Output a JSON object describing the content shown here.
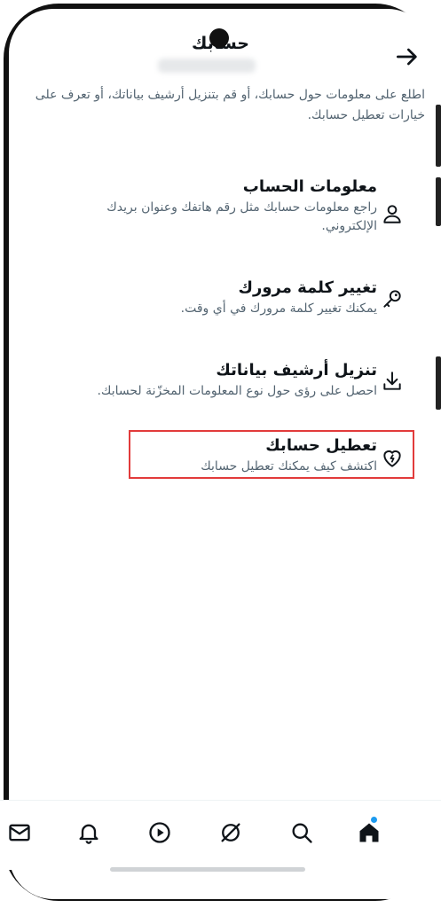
{
  "header": {
    "title": "حسابك"
  },
  "intro_text": "اطلع على معلومات حول حسابك، أو قم بتنزيل أرشيف بياناتك، أو تعرف على خيارات تعطيل حسابك.",
  "items": [
    {
      "title": "معلومات الحساب",
      "description": "راجع معلومات حسابك مثل رقم هاتفك وعنوان بريدك الإلكتروني.",
      "icon": "person-icon"
    },
    {
      "title": "تغيير كلمة مرورك",
      "description": "يمكنك تغيير كلمة مرورك في أي وقت.",
      "icon": "key-icon"
    },
    {
      "title": "تنزيل أرشيف بياناتك",
      "description": "احصل على رؤى حول نوع المعلومات المخزّنة لحسابك.",
      "icon": "download-icon"
    },
    {
      "title": "تعطيل حسابك",
      "description": "اكتشف كيف يمكنك تعطيل حسابك",
      "icon": "broken-heart-icon"
    }
  ],
  "nav": [
    "home-icon",
    "search-icon",
    "grok-icon",
    "play-icon",
    "bell-icon",
    "mail-icon"
  ],
  "colors": {
    "accent": "#1d9bf0",
    "highlight": "#e23b3b",
    "text": "#0f1419",
    "muted": "#536471"
  }
}
